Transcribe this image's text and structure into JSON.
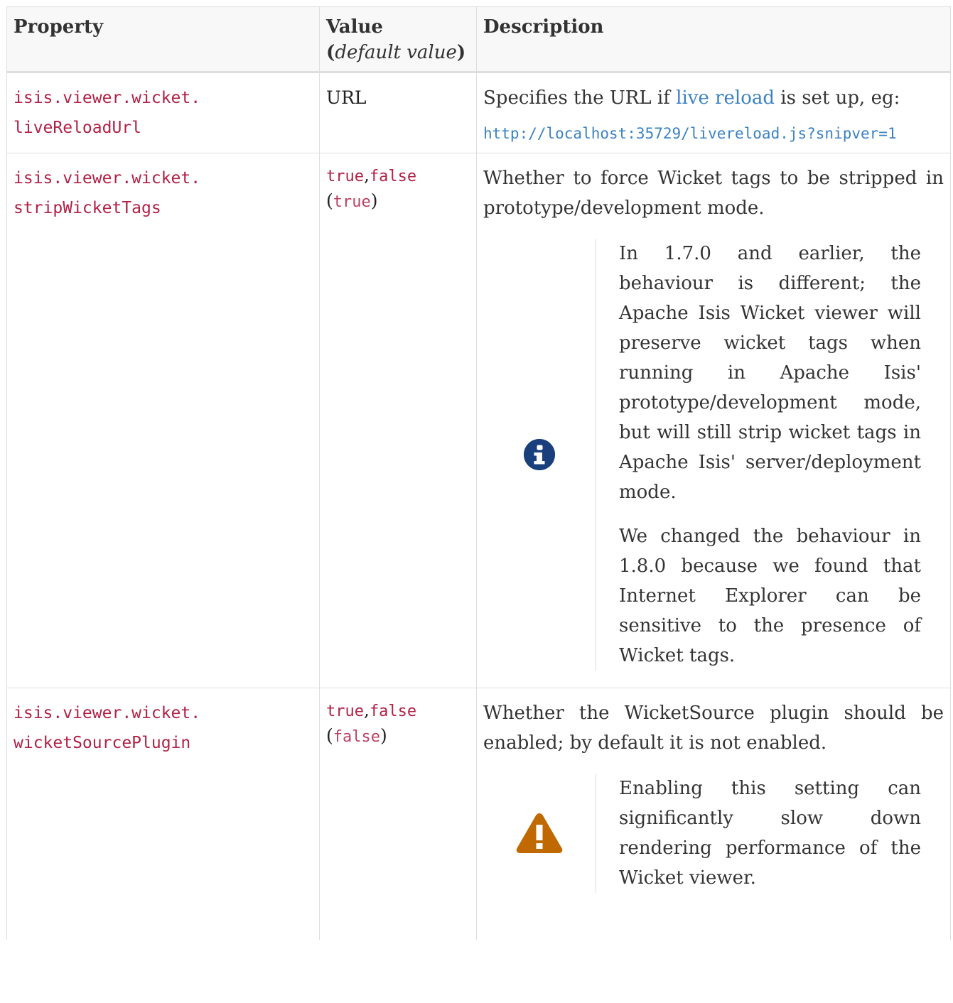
{
  "headers": {
    "property": "Property",
    "value_main": "Value",
    "value_default_open": "(",
    "value_default": "default value",
    "value_default_close": ")",
    "description": "Description"
  },
  "rows": [
    {
      "property_line1": "isis.viewer.wicket.",
      "property_line2": "liveReloadUrl",
      "value": "URL",
      "desc_before_link": "Specifies the URL if ",
      "desc_link": "live reload",
      "desc_after_link": " is set up, eg:",
      "example_url": "http://localhost:35729/livereload.js?snipver=1"
    },
    {
      "property_line1": "isis.viewer.wicket.",
      "property_line2": "stripWicketTags",
      "value_true": "true",
      "value_sep": ",",
      "value_false": "false",
      "default_open": "(",
      "default_value": "true",
      "default_close": ")",
      "description": "Whether to force Wicket tags to be stripped in prototype/development mode.",
      "note_icon": "info-icon",
      "note_p1": "In 1.7.0 and earlier, the behaviour is different; the Apache Isis Wicket viewer will preserve wicket tags when running in Apache Isis' prototype/development mode, but will still strip wicket tags in Apache Isis' server/deployment mode.",
      "note_p2": "We changed the behaviour in 1.8.0 because we found that Internet Explorer can be sensitive to the presence of Wicket tags."
    },
    {
      "property_line1": "isis.viewer.wicket.",
      "property_line2": "wicketSourcePlugin",
      "value_true": "true",
      "value_sep": ",",
      "value_false": "false",
      "default_open": "(",
      "default_value": "false",
      "default_close": ")",
      "description": "Whether the WicketSource plugin should be enabled; by default it is not enabled.",
      "warning_icon": "warning-icon",
      "warning_text": "Enabling this setting can significantly slow down rendering performance of the Wicket viewer."
    }
  ],
  "colors": {
    "code": "#b12146",
    "link": "#3b82c4",
    "info_icon": "#19407c",
    "warning_icon": "#bf6900",
    "border": "#dedede"
  }
}
